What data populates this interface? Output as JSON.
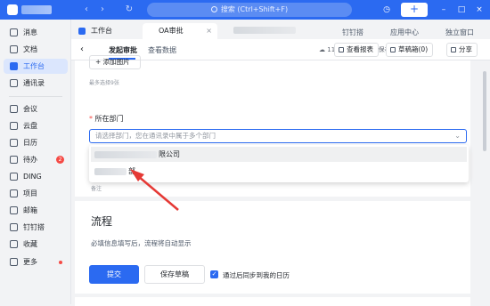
{
  "topbar": {
    "search_placeholder": "搜索 (Ctrl+Shift+F)",
    "add_label": "+"
  },
  "sidebar": {
    "items": [
      {
        "label": "消息"
      },
      {
        "label": "文档"
      },
      {
        "label": "工作台"
      },
      {
        "label": "通讯录"
      },
      {
        "label": "会议"
      },
      {
        "label": "云盘"
      },
      {
        "label": "日历"
      },
      {
        "label": "待办",
        "badge": "2"
      },
      {
        "label": "DING"
      },
      {
        "label": "项目"
      },
      {
        "label": "邮箱"
      },
      {
        "label": "钉钉搭"
      },
      {
        "label": "收藏"
      },
      {
        "label": "更多"
      }
    ]
  },
  "tabs": {
    "items": [
      {
        "label": "工作台"
      },
      {
        "label": "OA审批"
      }
    ],
    "close": "×",
    "links": [
      "钉钉搭",
      "应用中心",
      "独立窗口"
    ]
  },
  "header": {
    "back": "‹",
    "tabs": [
      "发起审批",
      "查看数据"
    ],
    "sync_text": "11:32 数据已实时保存",
    "buttons": [
      "查看报表",
      "草稿箱(0)",
      "分享"
    ]
  },
  "form": {
    "add_image": "+ 添加图片",
    "image_tip": "最多选择9张",
    "dept_required": "*",
    "dept_label": "所在部门",
    "dept_placeholder": "请选择部门，您在通讯录中属于多个部门",
    "options": [
      "限公司",
      "部"
    ],
    "remark": "备注"
  },
  "flow": {
    "title": "流程",
    "tip": "必填信息填写后，流程将自动显示",
    "submit": "提交",
    "save_draft": "保存草稿",
    "sync_label": "通过后同步到我的日历",
    "sync_checked": true
  },
  "colors": {
    "brand": "#2b6af1",
    "annotation_arrow": "#e53935"
  }
}
